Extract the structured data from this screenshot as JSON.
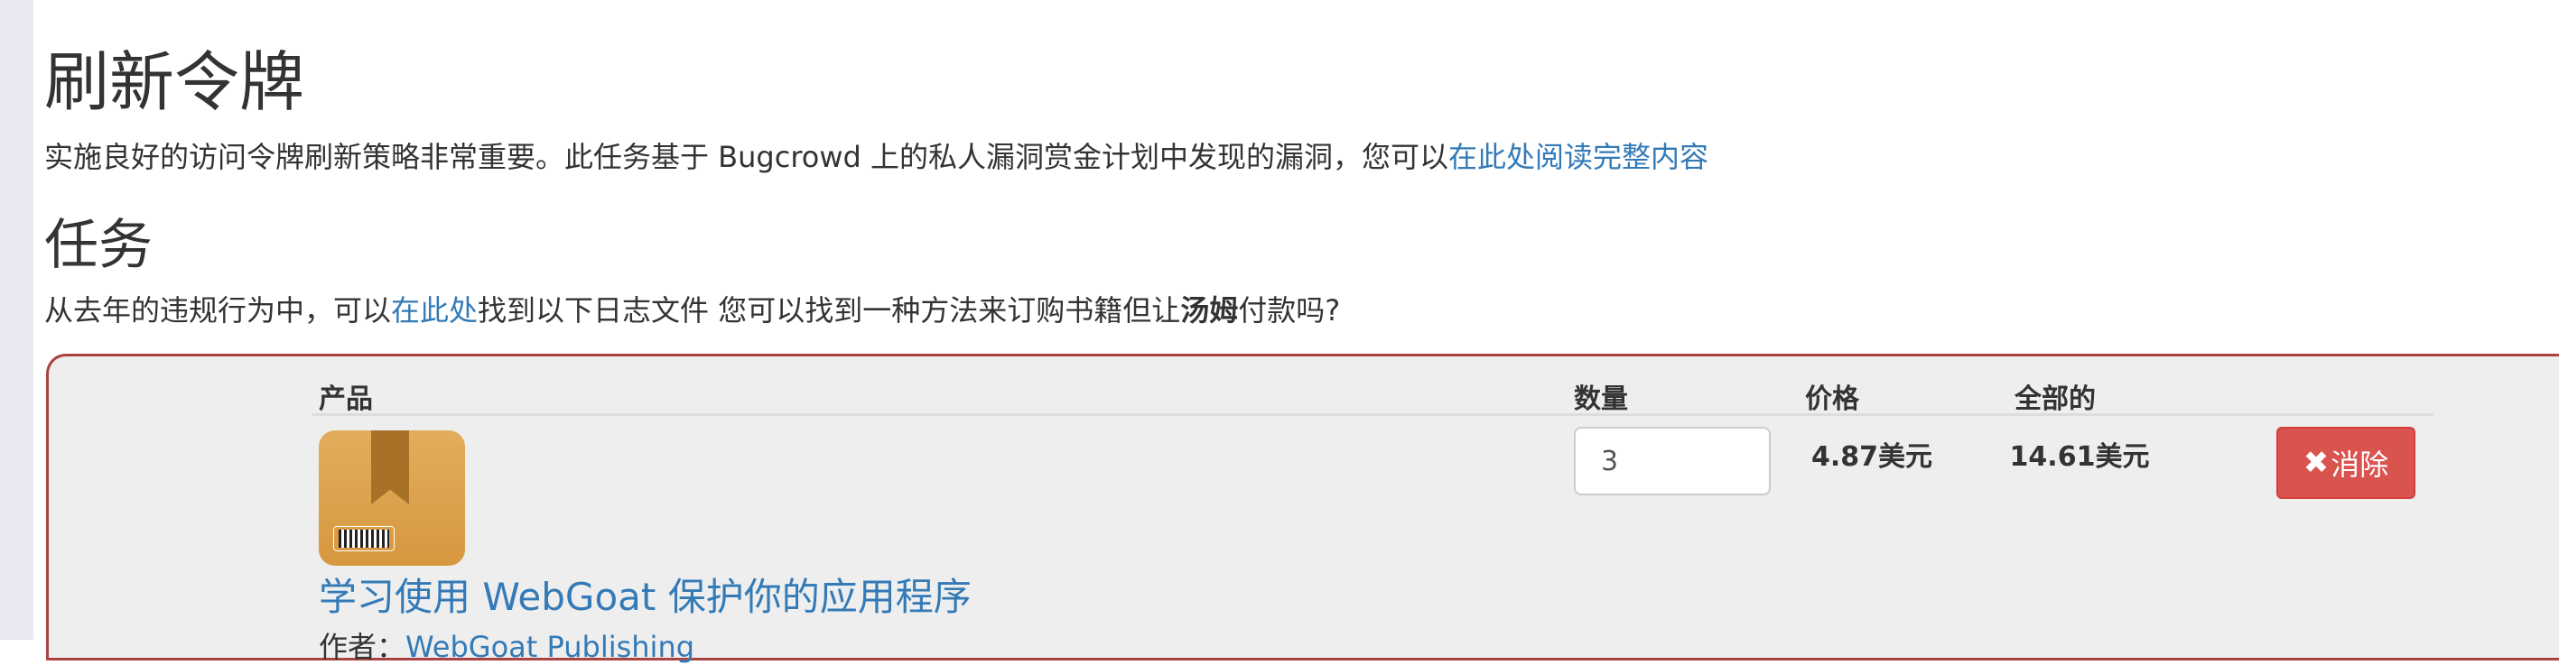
{
  "page": {
    "title": "刷新令牌",
    "intro_text": "实施良好的访问令牌刷新策略非常重要。此任务基于 Bugcrowd 上的私人漏洞赏金计划中发现的漏洞，您可以",
    "intro_link": "在此处阅读完整内容"
  },
  "task": {
    "heading": "任务",
    "text_before_link": "从去年的违规行为中，可以",
    "link": "在此处",
    "text_after_link": "找到以下日志文件 您可以找到一种方法来订购书籍但让",
    "bold_name": "汤姆",
    "text_end": "付款吗?"
  },
  "cart": {
    "headers": {
      "product": "产品",
      "quantity": "数量",
      "price": "价格",
      "total": "全部的"
    },
    "item": {
      "icon": "package-box-icon",
      "title": "学习使用 WebGoat 保护你的应用程序",
      "author_label": "作者：",
      "author": "WebGoat Publishing",
      "quantity": "3",
      "price": "4.87美元",
      "total": "14.61美元",
      "remove_icon": "x-icon",
      "remove_label": "消除"
    }
  },
  "colors": {
    "link": "#337ab7",
    "panel_border": "#a94442",
    "danger_button": "#d9534f",
    "panel_bg": "#eeeeee"
  }
}
